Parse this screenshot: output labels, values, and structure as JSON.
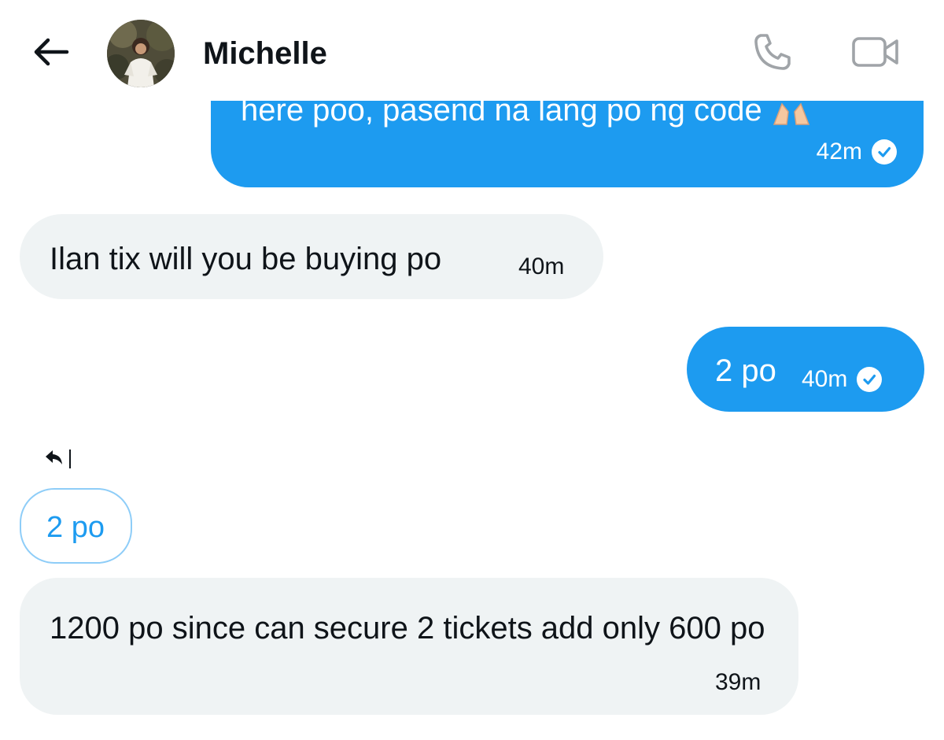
{
  "header": {
    "back_icon": "arrow-left-icon",
    "contact_name": "Michelle",
    "call_icon": "phone-icon",
    "video_icon": "video-camera-icon"
  },
  "messages": [
    {
      "direction": "outgoing",
      "text": "here poo, pasend na lang po ng code",
      "emoji": "folded-hands",
      "time": "42m",
      "status_icon": "check-circle-icon",
      "partially_hidden": true
    },
    {
      "direction": "incoming",
      "text": "Ilan tix will you be buying po",
      "time": "40m"
    },
    {
      "direction": "outgoing",
      "text": "2 po",
      "time": "40m",
      "status_icon": "check-circle-icon"
    },
    {
      "direction": "incoming",
      "reply_icon": "reply-arrow-icon",
      "quoted_text": "2 po",
      "text": "1200 po since can secure 2 tickets add only 600 po",
      "time": "39m"
    }
  ],
  "colors": {
    "outgoing_bubble": "#1d9bf0",
    "incoming_bubble": "#eff3f4",
    "quote_border": "#8ecdf8",
    "text_dark": "#0f1419",
    "icon_gray": "#a0a4a8"
  }
}
